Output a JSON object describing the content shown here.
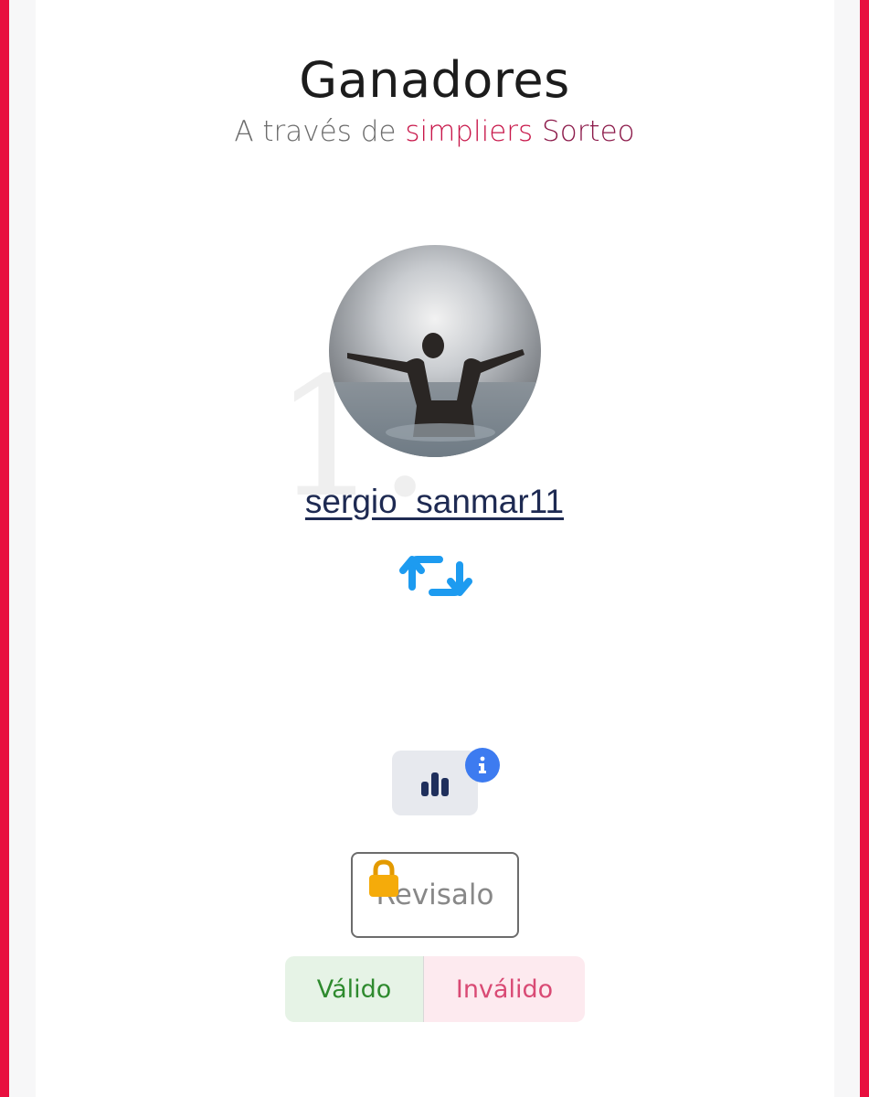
{
  "header": {
    "title": "Ganadores",
    "subtitle_prefix": "A través de",
    "subtitle_brand": "simpliers",
    "subtitle_suffix": "Sorteo"
  },
  "winner": {
    "rank": "1.",
    "username": "sergio_sanmar11",
    "avatar_icon": "profile-photo",
    "action_icon": "retweet-icon"
  },
  "stats": {
    "icon": "bar-chart-icon",
    "badge_icon": "info-icon"
  },
  "review": {
    "label": "Revisalo",
    "icon": "lock-icon"
  },
  "validation": {
    "valid_label": "Válido",
    "invalid_label": "Inválido"
  },
  "colors": {
    "accent": "#e8103f",
    "brand": "#c8174a",
    "username": "#1e2a52",
    "retweet": "#1d9bf0",
    "info": "#3d7bf0",
    "valid": "#2e8a2e",
    "invalid": "#d94a74"
  }
}
